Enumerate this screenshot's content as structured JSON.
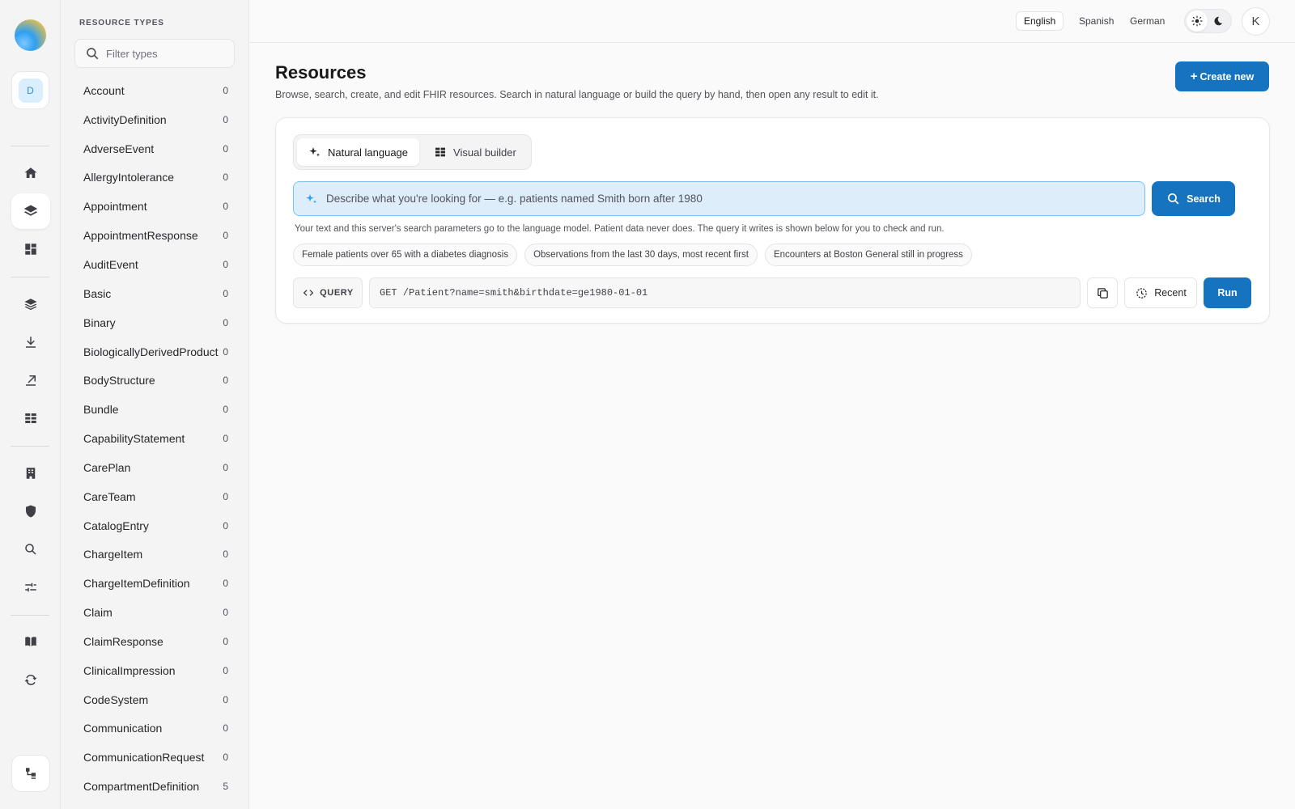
{
  "rail": {
    "workspace_letter": "D",
    "icons": [
      "home-icon",
      "layers-icon",
      "dashboard-icon",
      "stack-icon",
      "download-icon",
      "export-icon",
      "table-icon",
      "building-icon",
      "shield-icon",
      "search-icon",
      "sliders-icon",
      "book-icon",
      "sync-icon"
    ],
    "active": "layers-icon",
    "bottom_icon": "tree-icon"
  },
  "types_panel": {
    "heading": "RESOURCE TYPES",
    "filter_placeholder": "Filter types",
    "items": [
      {
        "name": "Account",
        "count": "0"
      },
      {
        "name": "ActivityDefinition",
        "count": "0"
      },
      {
        "name": "AdverseEvent",
        "count": "0"
      },
      {
        "name": "AllergyIntolerance",
        "count": "0"
      },
      {
        "name": "Appointment",
        "count": "0"
      },
      {
        "name": "AppointmentResponse",
        "count": "0"
      },
      {
        "name": "AuditEvent",
        "count": "0"
      },
      {
        "name": "Basic",
        "count": "0"
      },
      {
        "name": "Binary",
        "count": "0"
      },
      {
        "name": "BiologicallyDerivedProduct",
        "count": "0"
      },
      {
        "name": "BodyStructure",
        "count": "0"
      },
      {
        "name": "Bundle",
        "count": "0"
      },
      {
        "name": "CapabilityStatement",
        "count": "0"
      },
      {
        "name": "CarePlan",
        "count": "0"
      },
      {
        "name": "CareTeam",
        "count": "0"
      },
      {
        "name": "CatalogEntry",
        "count": "0"
      },
      {
        "name": "ChargeItem",
        "count": "0"
      },
      {
        "name": "ChargeItemDefinition",
        "count": "0"
      },
      {
        "name": "Claim",
        "count": "0"
      },
      {
        "name": "ClaimResponse",
        "count": "0"
      },
      {
        "name": "ClinicalImpression",
        "count": "0"
      },
      {
        "name": "CodeSystem",
        "count": "0"
      },
      {
        "name": "Communication",
        "count": "0"
      },
      {
        "name": "CommunicationRequest",
        "count": "0"
      },
      {
        "name": "CompartmentDefinition",
        "count": "5"
      }
    ]
  },
  "header": {
    "languages": [
      "English",
      "Spanish",
      "German"
    ],
    "selected_language": "English",
    "avatar_letter": "K"
  },
  "main": {
    "title": "Resources",
    "subtitle": "Browse, search, create, and edit FHIR resources. Search in natural language or build the query by hand, then open any result to edit it.",
    "create_label": "Create new",
    "tabs": [
      "Natural language",
      "Visual builder"
    ],
    "nl_placeholder": "Describe what you're looking for — e.g. patients named Smith born after 1980",
    "search_label": "Search",
    "note": "Your text and this server's search parameters go to the language model. Patient data never does. The query it writes is shown below for you to check and run.",
    "suggestions": [
      "Female patients over 65 with a diabetes diagnosis",
      "Observations from the last 30 days, most recent first",
      "Encounters at Boston General still in progress"
    ],
    "query_label": "QUERY",
    "query_value": "GET /Patient?name=smith&birthdate=ge1980-01-01",
    "recent_label": "Recent",
    "run_label": "Run"
  },
  "colors": {
    "primary": "#1673c0",
    "input_bg": "#ddeefa",
    "input_border": "#7cc1ee"
  }
}
